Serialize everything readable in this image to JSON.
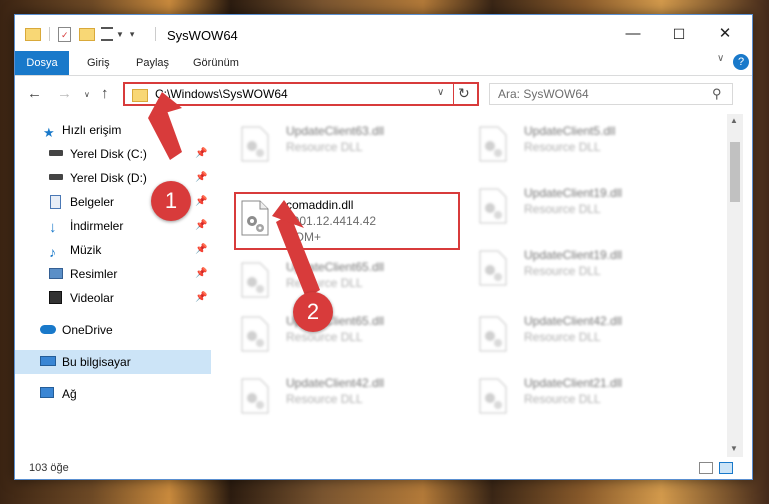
{
  "window": {
    "title": "SysWOW64",
    "controls": {
      "minimize": "—",
      "maximize": "☐",
      "close": "✕"
    }
  },
  "ribbon": {
    "tabs": [
      "Dosya",
      "Giriş",
      "Paylaş",
      "Görünüm"
    ],
    "help": "?"
  },
  "address_bar": {
    "path": "C:\\Windows\\SysWOW64"
  },
  "search": {
    "placeholder": "Ara: SysWOW64"
  },
  "sidebar": {
    "items": [
      {
        "label": "Hızlı erişim",
        "icon": "star-icon",
        "pinned": false
      },
      {
        "label": "Yerel Disk (C:)",
        "icon": "drive-icon",
        "pinned": true
      },
      {
        "label": "Yerel Disk (D:)",
        "icon": "drive-icon",
        "pinned": true
      },
      {
        "label": "Belgeler",
        "icon": "documents-icon",
        "pinned": true
      },
      {
        "label": "İndirmeler",
        "icon": "download-icon",
        "pinned": true
      },
      {
        "label": "Müzik",
        "icon": "music-icon",
        "pinned": true
      },
      {
        "label": "Resimler",
        "icon": "pictures-icon",
        "pinned": true
      },
      {
        "label": "Videolar",
        "icon": "video-icon",
        "pinned": true
      },
      {
        "label": "OneDrive",
        "icon": "cloud-icon",
        "pinned": false
      },
      {
        "label": "Bu bilgisayar",
        "icon": "computer-icon",
        "pinned": false
      },
      {
        "label": "Ağ",
        "icon": "network-icon",
        "pinned": false
      }
    ]
  },
  "files": {
    "left": [
      {
        "name": "UpdateClient63.dll",
        "desc": "Resource DLL"
      },
      {
        "name": "comaddin.dll",
        "desc": "2001.12.4414.42",
        "extra": "COM+"
      },
      {
        "name": "UpdateClient65.dll",
        "desc": "Resource DLL"
      },
      {
        "name": "UpdateClient65.dll",
        "desc": "Resource DLL"
      },
      {
        "name": "UpdateClient42.dll",
        "desc": "Resource DLL"
      }
    ],
    "right": [
      {
        "name": "UpdateClient5.dll",
        "desc": "Resource DLL"
      },
      {
        "name": "UpdateClient19.dll",
        "desc": "Resource DLL"
      },
      {
        "name": "UpdateClient19.dll",
        "desc": "Resource DLL"
      },
      {
        "name": "UpdateClient42.dll",
        "desc": "Resource DLL"
      },
      {
        "name": "UpdateClient21.dll",
        "desc": "Resource DLL"
      }
    ]
  },
  "status": {
    "count": "103 öğe"
  },
  "callouts": {
    "one": "1",
    "two": "2"
  },
  "colors": {
    "accent": "#1979ca",
    "highlight": "#d83b3b",
    "selection": "#cce4f7"
  }
}
